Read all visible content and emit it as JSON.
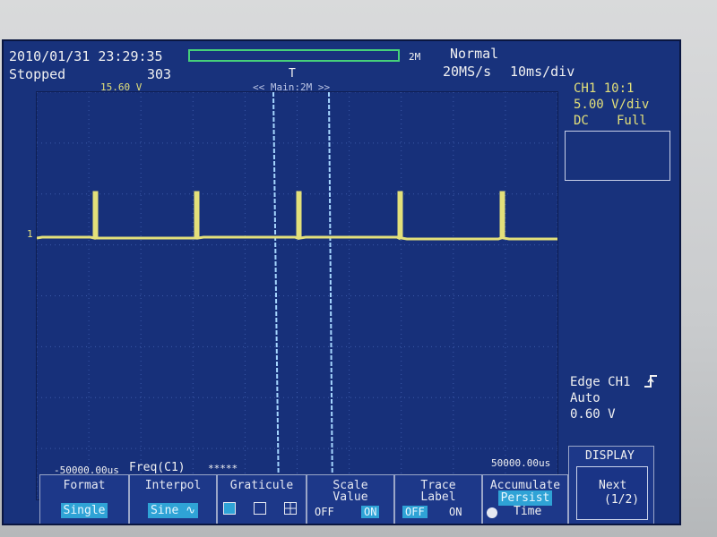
{
  "header": {
    "datetime": "2010/01/31 23:29:35",
    "run_state": "Stopped",
    "acq_count": "303",
    "memory": "2M",
    "trigger_mode": "Normal",
    "sample_rate": "20MS/s",
    "timebase": "10ms/div",
    "trigger_level_marker": "15.60 V",
    "zoom_label": "<< Main:2M >>",
    "trigger_pos_marker": "T"
  },
  "ch1": {
    "title": "CH1 10:1",
    "vdiv": "5.00 V/div",
    "coupling": "DC",
    "bandwidth": "Full",
    "ground_marker": "1"
  },
  "trigger": {
    "type": "Edge CH1",
    "mode": "Auto",
    "level": "0.60 V"
  },
  "bottom": {
    "left_time": "-50000.00us",
    "right_time": "50000.00us",
    "freq_label": "Freq(C1)",
    "freq_value": "*****"
  },
  "softkeys": [
    {
      "title": "Format",
      "value": "Single"
    },
    {
      "title": "Interpol",
      "value": "Sine"
    },
    {
      "title": "Graticule"
    },
    {
      "title": "Scale",
      "title2": "Value",
      "off": "OFF",
      "on": "ON"
    },
    {
      "title": "Trace",
      "title2": "Label",
      "off": "OFF",
      "on": "ON"
    },
    {
      "title": "Accumulate",
      "title2": "Persist",
      "value": "Time"
    }
  ],
  "display_panel": {
    "title": "DISPLAY",
    "next_label": "Next",
    "page": "(1/2)"
  },
  "colors": {
    "screen_bg": "#18327c",
    "trace": "#e3e07a",
    "cursor": "#9ad0ff",
    "grid": "#3b58a8",
    "highlight": "#2fa3d6"
  }
}
